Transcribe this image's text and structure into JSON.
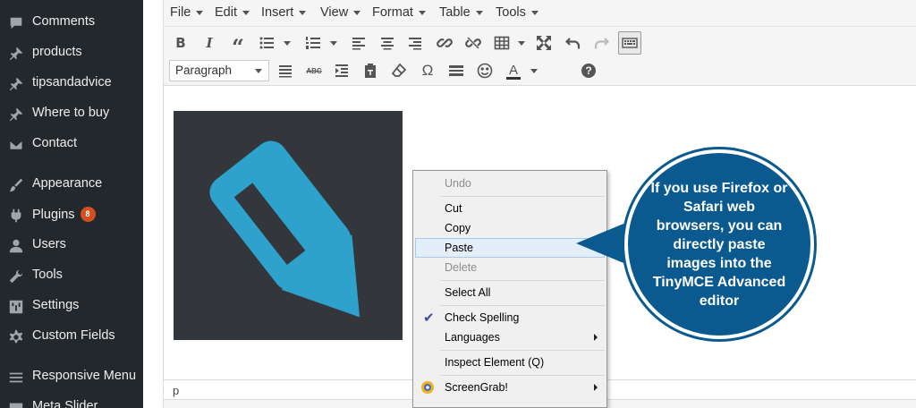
{
  "colors": {
    "sidebar_bg": "#23282d",
    "badge": "#d54e21",
    "callout": "#0b5a8f",
    "image_bg": "#33373c",
    "pencil": "#2ea2cc"
  },
  "sidebar": {
    "items": [
      {
        "label": "Comments",
        "icon": "comment-icon"
      },
      {
        "label": "products",
        "icon": "pin-icon"
      },
      {
        "label": "tipsandadvice",
        "icon": "pin-icon"
      },
      {
        "label": "Where to buy",
        "icon": "pin-icon"
      },
      {
        "label": "Contact",
        "icon": "mail-icon"
      },
      {
        "label": "Appearance",
        "icon": "brush-icon"
      },
      {
        "label": "Plugins",
        "icon": "plugin-icon",
        "badge": "8"
      },
      {
        "label": "Users",
        "icon": "user-icon"
      },
      {
        "label": "Tools",
        "icon": "wrench-icon"
      },
      {
        "label": "Settings",
        "icon": "sliders-icon"
      },
      {
        "label": "Custom Fields",
        "icon": "gear-icon"
      },
      {
        "label": "Responsive Menu",
        "icon": "menu-icon"
      },
      {
        "label": "Meta Slider",
        "icon": "slider-icon"
      }
    ]
  },
  "menubar": {
    "items": [
      "File",
      "Edit",
      "Insert",
      "View",
      "Format",
      "Table",
      "Tools"
    ]
  },
  "toolbar": {
    "format_value": "Paragraph",
    "row1_icons": [
      "bold-icon",
      "italic-icon",
      "blockquote-icon",
      "bullet-list-icon",
      "numbered-list-icon",
      "align-left-icon",
      "align-center-icon",
      "align-right-icon",
      "link-icon",
      "unlink-icon",
      "table-icon",
      "fullscreen-icon",
      "undo-icon",
      "redo-icon",
      "keyboard-icon"
    ],
    "row2_icons": [
      "justify-icon",
      "strikethrough-icon",
      "indent-icon",
      "paste-text-icon",
      "clear-formatting-icon",
      "omega-icon",
      "horizontal-rule-icon",
      "emoji-icon",
      "text-color-icon",
      "help-icon"
    ],
    "bold": "B",
    "italic": "I",
    "blockquote": "“",
    "strike": "ABC",
    "omega": "Ω",
    "text_color": "A",
    "help": "?"
  },
  "context_menu": {
    "items": [
      {
        "label": "Undo",
        "disabled": true
      },
      {
        "label": "Cut"
      },
      {
        "label": "Copy"
      },
      {
        "label": "Paste",
        "hover": true
      },
      {
        "label": "Delete",
        "disabled": true
      },
      {
        "label": "Select All"
      },
      {
        "label": "Check Spelling",
        "checked": true
      },
      {
        "label": "Languages",
        "submenu": true
      },
      {
        "label": "Inspect Element (Q)"
      },
      {
        "label": "ScreenGrab!",
        "submenu": true
      }
    ]
  },
  "statusbar": {
    "path": "p"
  },
  "callout": {
    "text": "If you use Firefox or Safari web browsers, you can directly paste images into the TinyMCE Advanced editor"
  }
}
